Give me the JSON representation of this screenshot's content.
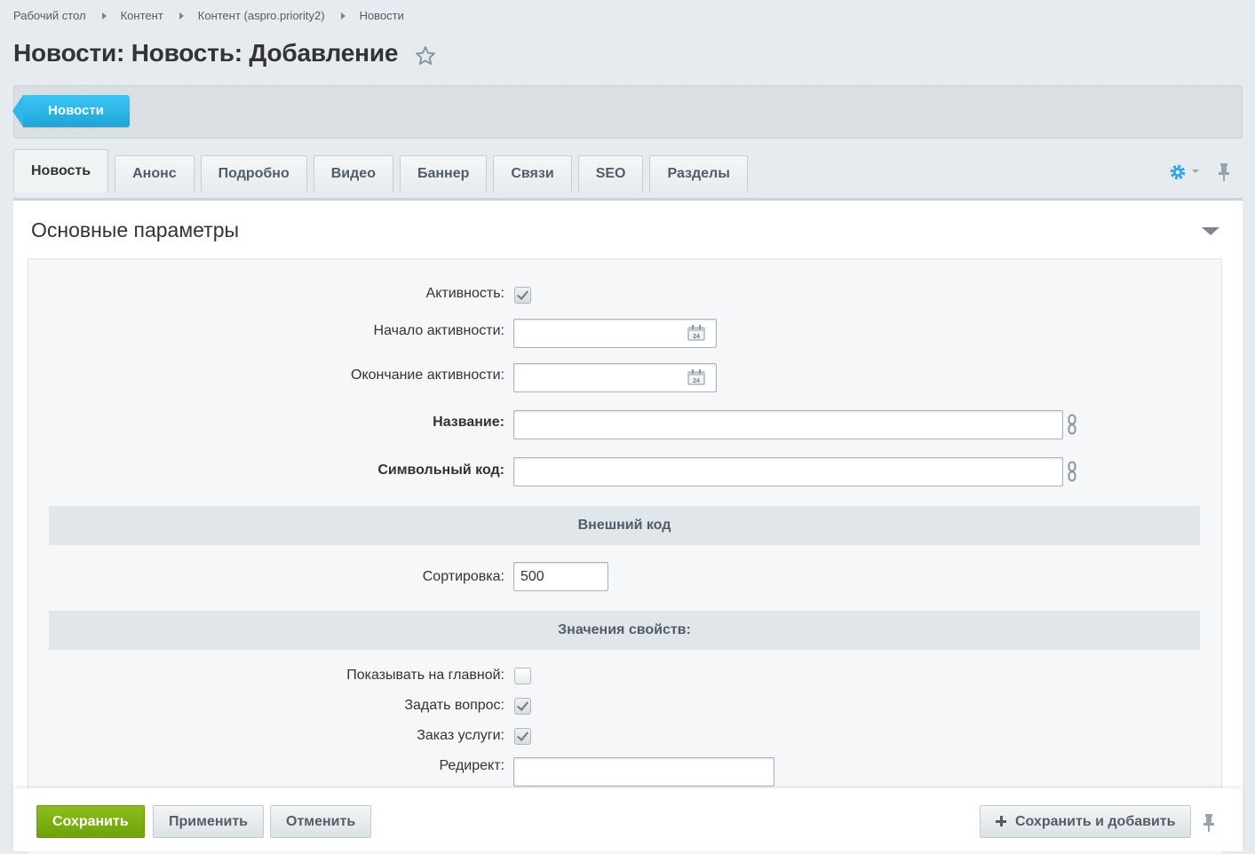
{
  "breadcrumbs": [
    "Рабочий стол",
    "Контент",
    "Контент (aspro.priority2)",
    "Новости"
  ],
  "page": {
    "title": "Новости: Новость: Добавление"
  },
  "toolbar": {
    "back_label": "Новости"
  },
  "tabs": [
    {
      "label": "Новость",
      "active": true
    },
    {
      "label": "Анонс"
    },
    {
      "label": "Подробно"
    },
    {
      "label": "Видео"
    },
    {
      "label": "Баннер"
    },
    {
      "label": "Связи"
    },
    {
      "label": "SEO"
    },
    {
      "label": "Разделы"
    }
  ],
  "section": {
    "title": "Основные параметры"
  },
  "form": {
    "active_label": "Активность:",
    "active_checked": true,
    "active_from_label": "Начало активности:",
    "active_from_value": "",
    "active_to_label": "Окончание активности:",
    "active_to_value": "",
    "name_label": "Название:",
    "name_value": "",
    "code_label": "Символьный код:",
    "code_value": "",
    "external_code_header": "Внешний код",
    "sort_label": "Сортировка:",
    "sort_value": "500",
    "properties_header": "Значения свойств:",
    "show_on_main_label": "Показывать на главной:",
    "show_on_main_checked": false,
    "ask_question_label": "Задать вопрос:",
    "ask_question_checked": true,
    "order_service_label": "Заказ услуги:",
    "order_service_checked": true,
    "redirect_label": "Редирект:",
    "redirect_value": ""
  },
  "footer": {
    "save_label": "Сохранить",
    "apply_label": "Применить",
    "cancel_label": "Отменить",
    "save_add_label": "Сохранить и добавить"
  },
  "colors": {
    "save_green": "#7bb111",
    "back_blue": "#2fb8eb",
    "page_bg": "#e5ebee"
  }
}
